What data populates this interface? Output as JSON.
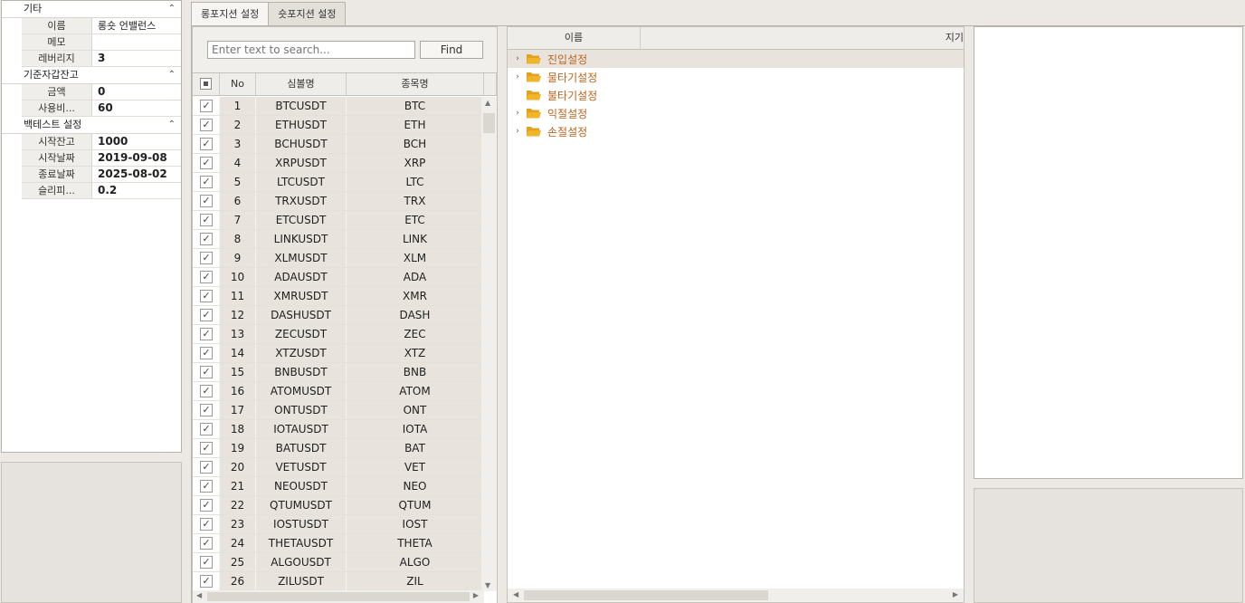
{
  "properties": {
    "categories": [
      {
        "title": "기타",
        "rows": [
          {
            "key": "이름",
            "value": "롱숏 언밸런스",
            "bold": false
          },
          {
            "key": "메모",
            "value": "",
            "bold": false
          },
          {
            "key": "레버리지",
            "value": "3",
            "bold": true
          }
        ]
      },
      {
        "title": "기준자갑잔고",
        "rows": [
          {
            "key": "금액",
            "value": "0",
            "bold": true
          },
          {
            "key": "사용비...",
            "value": "60",
            "bold": true
          }
        ]
      },
      {
        "title": "백테스트 설정",
        "rows": [
          {
            "key": "시작잔고",
            "value": "1000",
            "bold": true
          },
          {
            "key": "시작날짜",
            "value": "2019-09-08",
            "bold": true
          },
          {
            "key": "종료날짜",
            "value": "2025-08-02",
            "bold": true
          },
          {
            "key": "슬리피...",
            "value": "0.2",
            "bold": true
          }
        ]
      }
    ]
  },
  "tabs": [
    {
      "label": "롱포지션 설정",
      "active": true
    },
    {
      "label": "숏포지션 설정",
      "active": false
    }
  ],
  "search": {
    "placeholder": "Enter text to search...",
    "find_label": "Find"
  },
  "grid": {
    "columns": {
      "no": "No",
      "symbol": "심볼명",
      "name": "종목명"
    },
    "rows": [
      {
        "no": "1",
        "symbol": "BTCUSDT",
        "name": "BTC",
        "checked": true
      },
      {
        "no": "2",
        "symbol": "ETHUSDT",
        "name": "ETH",
        "checked": true
      },
      {
        "no": "3",
        "symbol": "BCHUSDT",
        "name": "BCH",
        "checked": true
      },
      {
        "no": "4",
        "symbol": "XRPUSDT",
        "name": "XRP",
        "checked": true
      },
      {
        "no": "5",
        "symbol": "LTCUSDT",
        "name": "LTC",
        "checked": true
      },
      {
        "no": "6",
        "symbol": "TRXUSDT",
        "name": "TRX",
        "checked": true
      },
      {
        "no": "7",
        "symbol": "ETCUSDT",
        "name": "ETC",
        "checked": true
      },
      {
        "no": "8",
        "symbol": "LINKUSDT",
        "name": "LINK",
        "checked": true
      },
      {
        "no": "9",
        "symbol": "XLMUSDT",
        "name": "XLM",
        "checked": true
      },
      {
        "no": "10",
        "symbol": "ADAUSDT",
        "name": "ADA",
        "checked": true
      },
      {
        "no": "11",
        "symbol": "XMRUSDT",
        "name": "XMR",
        "checked": true
      },
      {
        "no": "12",
        "symbol": "DASHUSDT",
        "name": "DASH",
        "checked": true
      },
      {
        "no": "13",
        "symbol": "ZECUSDT",
        "name": "ZEC",
        "checked": true
      },
      {
        "no": "14",
        "symbol": "XTZUSDT",
        "name": "XTZ",
        "checked": true
      },
      {
        "no": "15",
        "symbol": "BNBUSDT",
        "name": "BNB",
        "checked": true
      },
      {
        "no": "16",
        "symbol": "ATOMUSDT",
        "name": "ATOM",
        "checked": true
      },
      {
        "no": "17",
        "symbol": "ONTUSDT",
        "name": "ONT",
        "checked": true
      },
      {
        "no": "18",
        "symbol": "IOTAUSDT",
        "name": "IOTA",
        "checked": true
      },
      {
        "no": "19",
        "symbol": "BATUSDT",
        "name": "BAT",
        "checked": true
      },
      {
        "no": "20",
        "symbol": "VETUSDT",
        "name": "VET",
        "checked": true
      },
      {
        "no": "21",
        "symbol": "NEOUSDT",
        "name": "NEO",
        "checked": true
      },
      {
        "no": "22",
        "symbol": "QTUMUSDT",
        "name": "QTUM",
        "checked": true
      },
      {
        "no": "23",
        "symbol": "IOSTUSDT",
        "name": "IOST",
        "checked": true
      },
      {
        "no": "24",
        "symbol": "THETAUSDT",
        "name": "THETA",
        "checked": true
      },
      {
        "no": "25",
        "symbol": "ALGOUSDT",
        "name": "ALGO",
        "checked": true
      },
      {
        "no": "26",
        "symbol": "ZILUSDT",
        "name": "ZIL",
        "checked": true
      }
    ]
  },
  "tree": {
    "columns": {
      "name": "이름",
      "value": "지기"
    },
    "nodes": [
      {
        "label": "진입설정",
        "expandable": true,
        "selected": true
      },
      {
        "label": "물타기설정",
        "expandable": true,
        "selected": false
      },
      {
        "label": "불타기설정",
        "expandable": false,
        "selected": false
      },
      {
        "label": "익절설정",
        "expandable": true,
        "selected": false
      },
      {
        "label": "손절설정",
        "expandable": true,
        "selected": false
      }
    ]
  },
  "icons": {
    "category_collapse": "chevron-up-icon",
    "tree_expand": "chevron-right-icon",
    "tree_node": "folder-open-icon",
    "checkbox": "checkmark-icon"
  },
  "colors": {
    "tree_label": "#C0641A",
    "folder": "#F0B429",
    "row_bg": "#E8E4DD"
  }
}
